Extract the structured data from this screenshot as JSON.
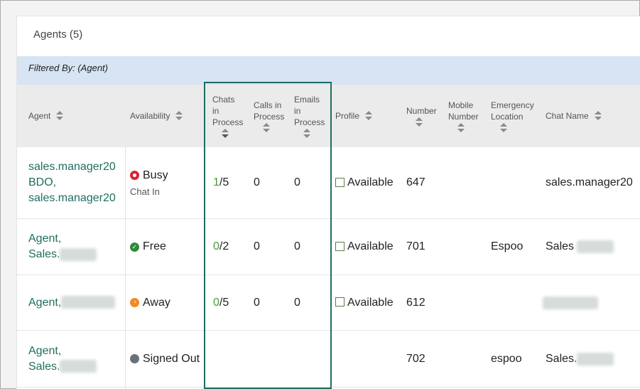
{
  "panel": {
    "title": "Agents (5)"
  },
  "filter": {
    "text": "Filtered By: (Agent)"
  },
  "columns": {
    "agent": "Agent",
    "availability": "Availability",
    "chats": [
      "Chats",
      "in",
      "Process"
    ],
    "calls": [
      "Calls in",
      "Process"
    ],
    "emails": [
      "Emails",
      "in",
      "Process"
    ],
    "profile": "Profile",
    "number": "Number",
    "mobile": [
      "Mobile",
      "Number"
    ],
    "emergency": [
      "Emergency",
      "Location"
    ],
    "chat_name": "Chat Name"
  },
  "rows": [
    {
      "agent": [
        "sales.manager20",
        "BDO,",
        "sales.manager20"
      ],
      "status": "Busy",
      "status_sub": "Chat In",
      "chats_active": "1",
      "chats_max": "/5",
      "calls": "0",
      "emails": "0",
      "profile": "Available",
      "number": "647",
      "mobile": "",
      "emergency": "",
      "chat_name": "sales.manager20"
    },
    {
      "agent": [
        "Agent,",
        "Sales."
      ],
      "status": "Free",
      "status_sub": "",
      "chats_active": "0",
      "chats_max": "/2",
      "calls": "0",
      "emails": "0",
      "profile": "Available",
      "number": "701",
      "mobile": "",
      "emergency": "Espoo",
      "chat_name": "Sales"
    },
    {
      "agent": [
        "Agent,"
      ],
      "status": "Away",
      "status_sub": "",
      "chats_active": "0",
      "chats_max": "/5",
      "calls": "0",
      "emails": "0",
      "profile": "Available",
      "number": "612",
      "mobile": "",
      "emergency": "",
      "chat_name": ""
    },
    {
      "agent": [
        "Agent,",
        "Sales."
      ],
      "status": "Signed Out",
      "status_sub": "",
      "chats_active": "",
      "chats_max": "",
      "calls": "",
      "emails": "",
      "profile": "",
      "number": "702",
      "mobile": "",
      "emergency": "espoo",
      "chat_name": "Sales."
    }
  ],
  "colors": {
    "accent": "#1f6e5f",
    "filter_bg": "#d6e4f3",
    "header_bg": "#ebebeb",
    "busy": "#d9252f",
    "free": "#2d8a3c",
    "away": "#f08a24",
    "signed_out": "#6a7178"
  }
}
